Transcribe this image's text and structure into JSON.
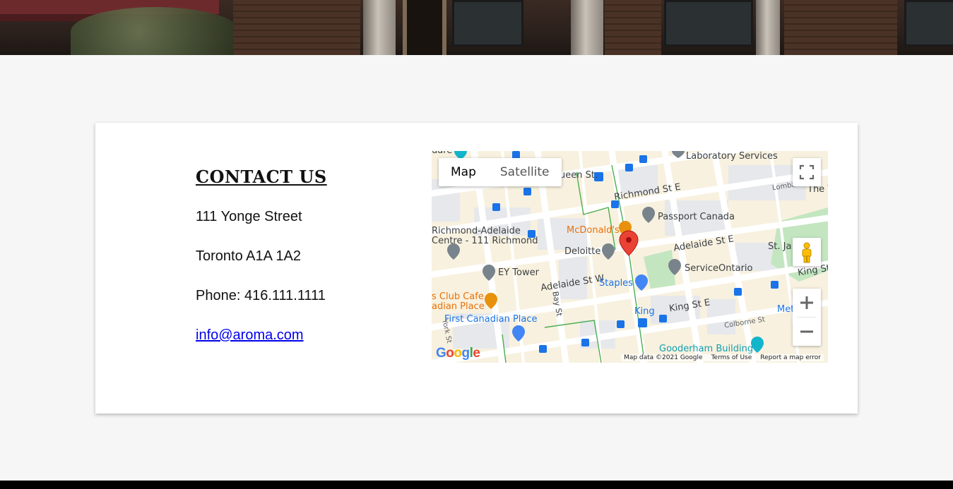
{
  "contact": {
    "heading": "CONTACT US",
    "address_line1": "111 Yonge Street",
    "address_line2": "Toronto A1A 1A2",
    "phone": "Phone: 416.111.1111",
    "email": "info@aroma.com"
  },
  "map": {
    "type_buttons": [
      "Map",
      "Satellite"
    ],
    "active_type": "Map",
    "labels": {
      "laboratory": "Laboratory Services",
      "queen": "ueen St.",
      "richmond_st_e": "Richmond St E",
      "passport": "Passport Canada",
      "lombard": "Lombard",
      "the_w": "The V",
      "richmond_adelaide_1": "Richmond-Adelaide",
      "richmond_adelaide_2": "Centre - 111 Richmond",
      "mcdonalds": "McDonald's",
      "deloitte": "Deloitte",
      "adelaide_st_e": "Adelaide St E",
      "st_james": "St. Ja",
      "ey_tower": "EY Tower",
      "adelaide_st_w": "Adelaide St W",
      "service_ontario": "ServiceOntario",
      "staples": "Staples",
      "king_st_e_right": "King St",
      "club_cafe_1": "s Club Cafe",
      "club_cafe_2": "adian Place",
      "bay_st": "Bay St",
      "king": "King",
      "king_st_e": "King St E",
      "met": "Met",
      "first_canadian": "First Canadian Place",
      "york_st": "York St",
      "colborne": "Colborne St",
      "gooderham": "Gooderham Building",
      "quare": "uare"
    },
    "logo": "Google",
    "attribution": [
      "Map data ©2021 Google",
      "Terms of Use",
      "Report a map error"
    ],
    "colors": {
      "background": "#f8f1df",
      "road": "#ffffff",
      "block": "#e9ebee",
      "park": "#c3e6c0",
      "transit_line": "#5cb85c",
      "marker": "#ea4335",
      "poi_gray": "#78838c",
      "poi_blue": "#4285f4",
      "poi_orange": "#e8910d",
      "poi_teal": "#12b5cb"
    }
  }
}
